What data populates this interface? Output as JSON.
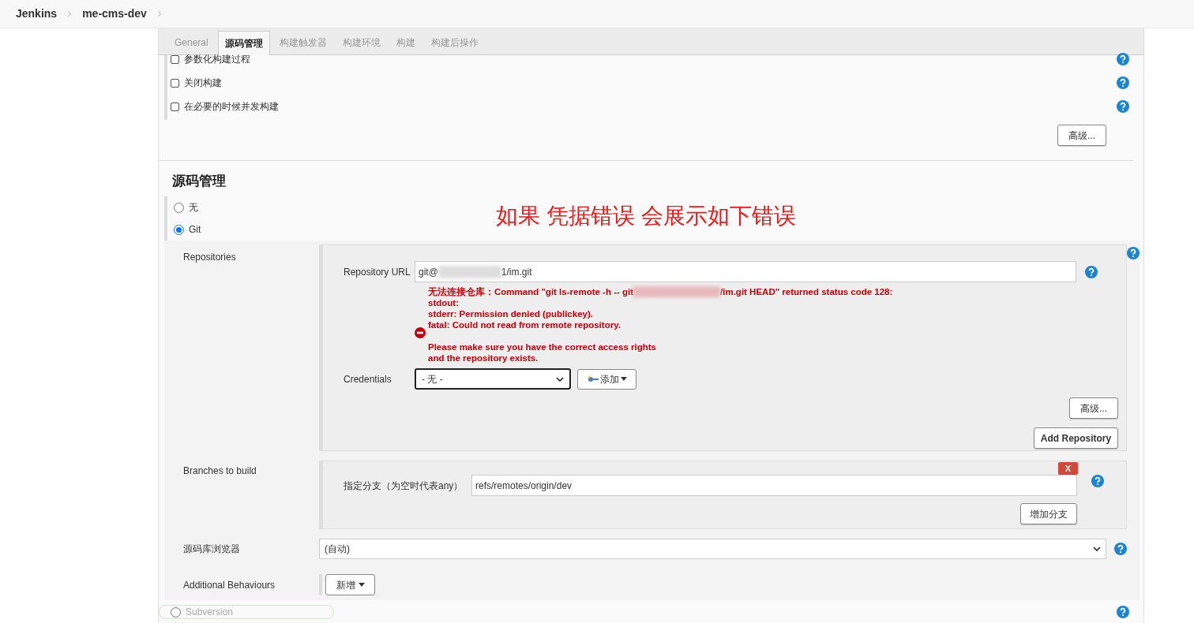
{
  "breadcrumb": [
    "Jenkins",
    "me-cms-dev"
  ],
  "tabs": [
    {
      "label": "General",
      "selected": false
    },
    {
      "label": "源码管理",
      "selected": true
    },
    {
      "label": "构建触发器",
      "selected": false
    },
    {
      "label": "构建环境",
      "selected": false
    },
    {
      "label": "构建",
      "selected": false
    },
    {
      "label": "构建后操作",
      "selected": false
    }
  ],
  "general_options": [
    {
      "label": "参数化构建过程",
      "checked": false
    },
    {
      "label": "关闭构建",
      "checked": false
    },
    {
      "label": "在必要的时候并发构建",
      "checked": false
    }
  ],
  "general_advanced_button": "高级...",
  "scm": {
    "heading": "源码管理",
    "annotation": "如果 凭据错误 会展示如下错误",
    "options": [
      {
        "label": "无",
        "selected": false
      },
      {
        "label": "Git",
        "selected": true
      }
    ],
    "repositories_label": "Repositories",
    "repository_url_label": "Repository URL",
    "repository_url_parts": [
      "git@",
      "1/im.git"
    ],
    "error_first_line_parts": [
      "无法连接仓库：Command \"git ls-remote -h -- git",
      "/im.git HEAD\" returned status code 128:"
    ],
    "error_rest": "stdout:\nstderr: Permission denied (publickey).\nfatal: Could not read from remote repository.\n\nPlease make sure you have the correct access rights\nand the repository exists.",
    "credentials_label": "Credentials",
    "credentials_value": "- 无 -",
    "add_button": "添加",
    "repo_advanced_button": "高级...",
    "add_repository_button": "Add Repository",
    "branches_label": "Branches to build",
    "branch_delete_button": "X",
    "branch_spec_label": "指定分支（为空时代表any）",
    "branch_spec_value": "refs/remotes/origin/dev",
    "add_branch_button": "增加分支",
    "browser_label": "源码库浏览器",
    "browser_value": "(自动)",
    "behaviours_label": "Additional Behaviours",
    "behaviours_button": "新增",
    "next_option": {
      "label": "Subversion",
      "selected": false
    }
  }
}
